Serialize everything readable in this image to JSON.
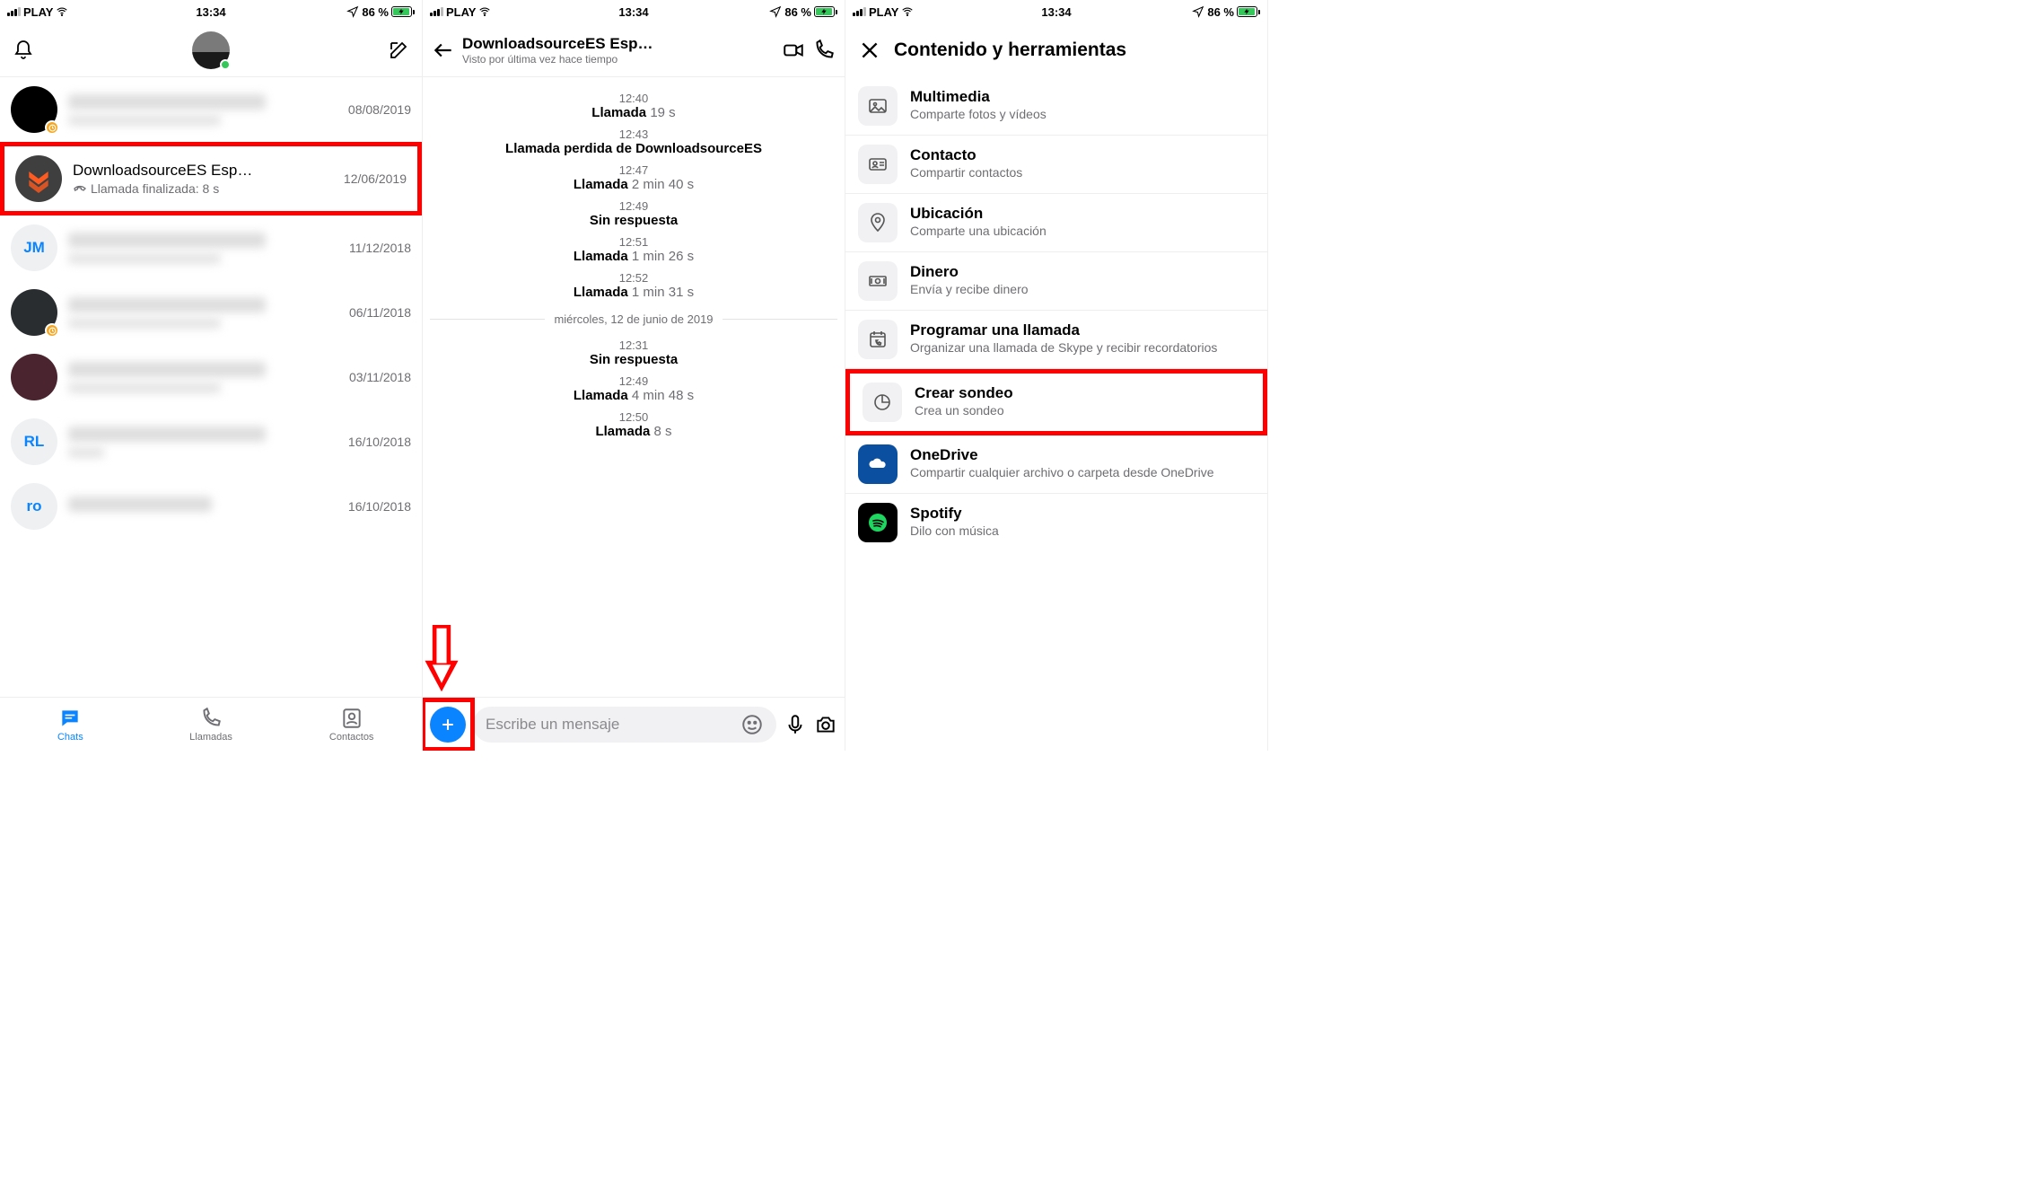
{
  "status": {
    "carrier": "PLAY",
    "time": "13:34",
    "battery": "86 %"
  },
  "p1": {
    "chats": [
      {
        "date": "08/08/2019"
      },
      {
        "title": "DownloadsourceES Esp…",
        "sub": "Llamada finalizada: 8 s",
        "date": "12/06/2019"
      },
      {
        "date": "11/12/2018",
        "init": "JM"
      },
      {
        "date": "06/11/2018"
      },
      {
        "date": "03/11/2018"
      },
      {
        "date": "16/10/2018",
        "init": "RL"
      },
      {
        "date": "16/10/2018",
        "init": "ro"
      }
    ],
    "tabs": {
      "chats": "Chats",
      "calls": "Llamadas",
      "contacts": "Contactos"
    }
  },
  "p2": {
    "title": "DownloadsourceES Esp…",
    "subtitle": "Visto por última vez hace tiempo",
    "events": [
      {
        "time": "12:40",
        "text": "Llamada",
        "dur": " 19 s"
      },
      {
        "time": "12:43",
        "text": "Llamada perdida de DownloadsourceES",
        "dur": ""
      },
      {
        "time": "12:47",
        "text": "Llamada",
        "dur": " 2 min 40 s"
      },
      {
        "time": "12:49",
        "text": "Sin respuesta",
        "dur": ""
      },
      {
        "time": "12:51",
        "text": "Llamada",
        "dur": " 1 min 26 s"
      },
      {
        "time": "12:52",
        "text": "Llamada",
        "dur": " 1 min 31 s"
      }
    ],
    "date_div": "miércoles, 12 de junio de 2019",
    "events2": [
      {
        "time": "12:31",
        "text": "Sin respuesta",
        "dur": ""
      },
      {
        "time": "12:49",
        "text": "Llamada",
        "dur": " 4 min 48 s"
      },
      {
        "time": "12:50",
        "text": "Llamada",
        "dur": " 8 s"
      }
    ],
    "placeholder": "Escribe un mensaje"
  },
  "p3": {
    "title": "Contenido y herramientas",
    "items": [
      {
        "title": "Multimedia",
        "sub": "Comparte fotos y vídeos"
      },
      {
        "title": "Contacto",
        "sub": "Compartir contactos"
      },
      {
        "title": "Ubicación",
        "sub": "Comparte una ubicación"
      },
      {
        "title": "Dinero",
        "sub": "Envía y recibe dinero"
      },
      {
        "title": "Programar una llamada",
        "sub": "Organizar una llamada de Skype y recibir recordatorios"
      },
      {
        "title": "Crear sondeo",
        "sub": "Crea un sondeo"
      },
      {
        "title": "OneDrive",
        "sub": "Compartir cualquier archivo o carpeta desde OneDrive"
      },
      {
        "title": "Spotify",
        "sub": "Dilo con música"
      }
    ]
  }
}
